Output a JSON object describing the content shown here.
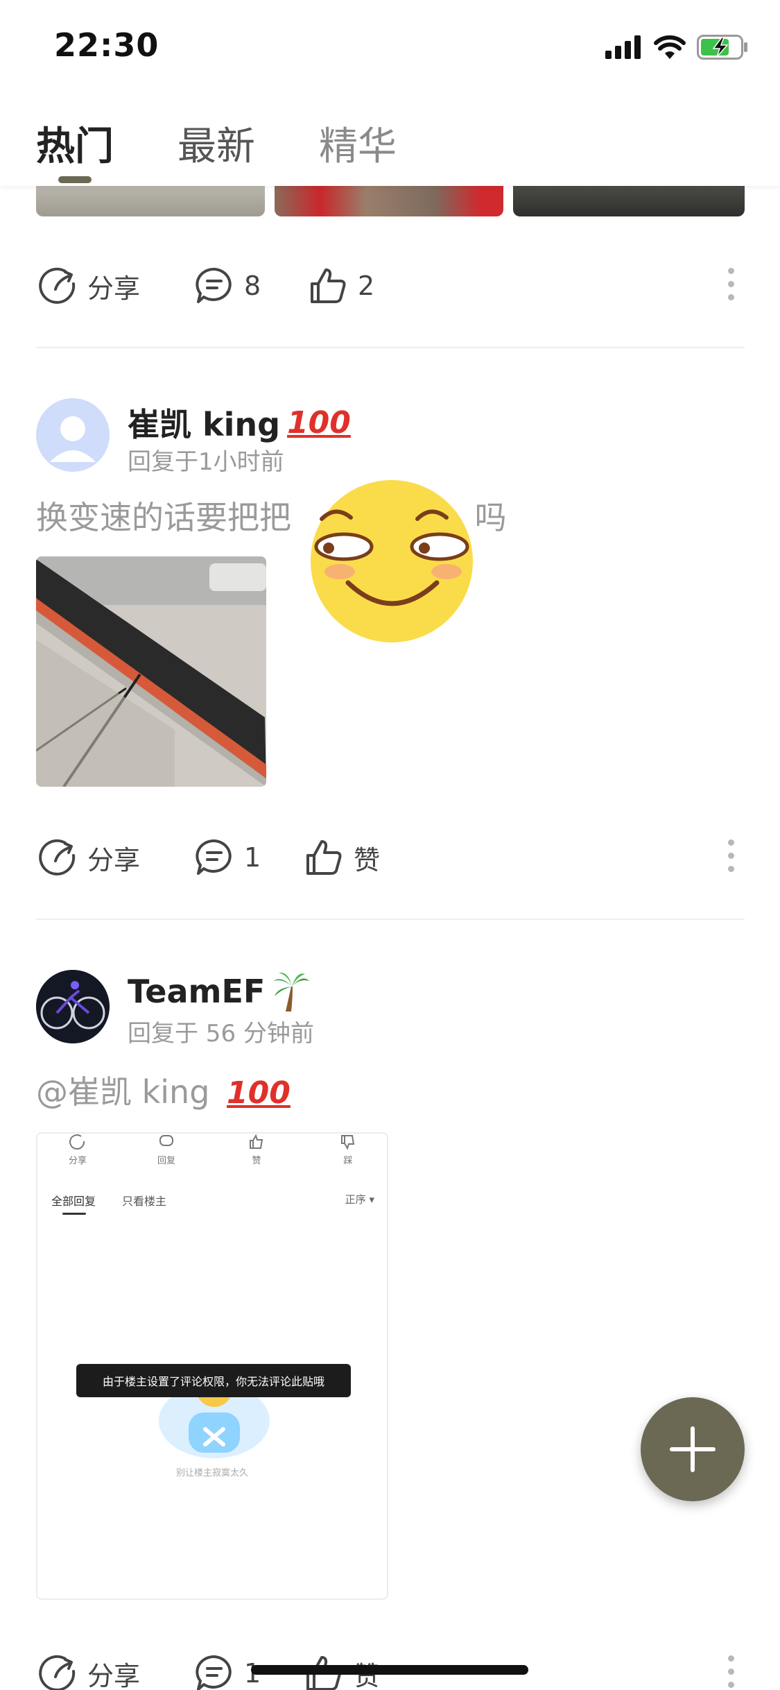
{
  "status_bar": {
    "time": "22:30",
    "icons": [
      "cellular-signal-icon",
      "wifi-icon",
      "battery-charging-icon"
    ]
  },
  "tabs": [
    {
      "label": "热门",
      "active": true
    },
    {
      "label": "最新",
      "active": false
    },
    {
      "label": "精华",
      "active": false
    }
  ],
  "posts": [
    {
      "actions": {
        "share_label": "分享",
        "comment_count": "8",
        "like_label": "2"
      }
    },
    {
      "author": "崔凯 king",
      "badge": "100",
      "meta": "回复于1小时前",
      "text": "换变速的话要把把",
      "text_tail": "吗",
      "actions": {
        "share_label": "分享",
        "comment_count": "1",
        "like_label": "赞"
      }
    },
    {
      "author": "TeamEF",
      "meta": "回复于 56 分钟前",
      "text": "@崔凯 king",
      "badge": "100",
      "screenshot": {
        "icon_labels": [
          "分享",
          "回复",
          "赞",
          "踩"
        ],
        "tab_all": "全部回复",
        "tab_owner": "只看楼主",
        "sort": "正序",
        "toast": "由于楼主设置了评论权限，你无法评论此贴哦",
        "caption": "别让楼主寂寞太久"
      },
      "actions": {
        "share_label": "分享",
        "comment_count": "1",
        "like_label": "赞"
      }
    }
  ],
  "colors": {
    "accent": "#6b6854",
    "badge_red": "#e0302a",
    "muted_text": "#9a9a9a"
  }
}
